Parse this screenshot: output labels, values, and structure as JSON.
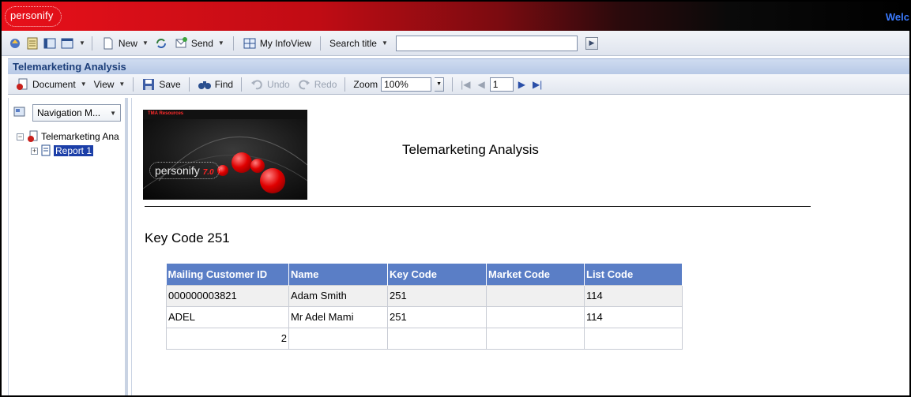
{
  "brand": {
    "logo_text": "personify",
    "welcome": "Welc"
  },
  "toolbar": {
    "new_label": "New",
    "send_label": "Send",
    "infoview_label": "My InfoView",
    "search_label": "Search title",
    "search_value": ""
  },
  "document": {
    "title": "Telemarketing Analysis",
    "menu_document": "Document",
    "menu_view": "View",
    "save_label": "Save",
    "find_label": "Find",
    "undo_label": "Undo",
    "redo_label": "Redo",
    "zoom_label": "Zoom",
    "zoom_value": "100%",
    "page_value": "1"
  },
  "nav": {
    "select_label": "Navigation M...",
    "tree_root": "Telemarketing Ana",
    "tree_child": "Report 1"
  },
  "report": {
    "banner_top": "TMA Resources",
    "banner_logo": "personify",
    "banner_version": "7.0",
    "title": "Telemarketing Analysis",
    "section_title": "Key Code 251",
    "columns": [
      "Mailing Customer ID",
      "Name",
      "Key Code",
      "Market Code",
      "List Code"
    ],
    "rows": [
      [
        "000000003821",
        "Adam Smith",
        "251",
        "",
        "114"
      ],
      [
        "ADEL",
        "Mr Adel Mami",
        "251",
        "",
        "114"
      ],
      [
        "2",
        "",
        "",
        "",
        ""
      ]
    ]
  },
  "colors": {
    "header_blue": "#5a7ec6",
    "brand_red": "#e8101a",
    "title_blue": "#1d3f7a"
  }
}
